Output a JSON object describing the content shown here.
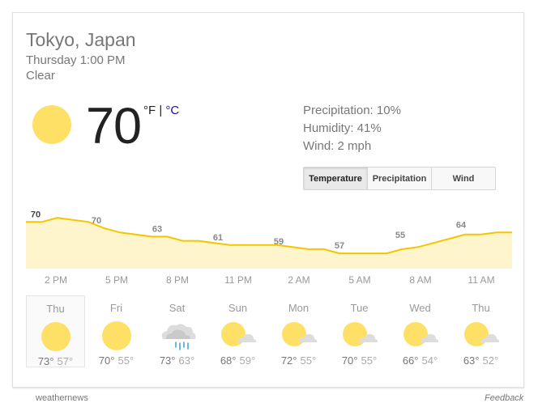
{
  "location": "Tokyo, Japan",
  "datetime": "Thursday 1:00 PM",
  "condition": "Clear",
  "current": {
    "temp": "70",
    "unit_f": "°F",
    "unit_sep": "|",
    "unit_c": "°C",
    "icon": "sun-icon"
  },
  "stats": {
    "precipitation": "Precipitation: 10%",
    "humidity": "Humidity: 41%",
    "wind": "Wind: 2 mph"
  },
  "tabs": [
    {
      "label": "Temperature",
      "active": true
    },
    {
      "label": "Precipitation",
      "active": false
    },
    {
      "label": "Wind",
      "active": false
    }
  ],
  "chart_data": {
    "type": "area",
    "x_labels": [
      "2 PM",
      "5 PM",
      "8 PM",
      "11 PM",
      "2 AM",
      "5 AM",
      "8 AM",
      "11 AM"
    ],
    "values": [
      70,
      70,
      72,
      71,
      70,
      67,
      65,
      64,
      63,
      63,
      61,
      61,
      60,
      59,
      59,
      59,
      59,
      58,
      57,
      57,
      55,
      55,
      55,
      55,
      57,
      58,
      60,
      62,
      64,
      64,
      65,
      65
    ],
    "labeled": [
      {
        "index": 0,
        "label": "70"
      },
      {
        "index": 3,
        "label": "70"
      },
      {
        "index": 6,
        "label": "63"
      },
      {
        "index": 9,
        "label": "61"
      },
      {
        "index": 12,
        "label": "59"
      },
      {
        "index": 15,
        "label": "57"
      },
      {
        "index": 18,
        "label": "55"
      },
      {
        "index": 21,
        "label": "64"
      }
    ],
    "line_color": "#f6c500",
    "fill_color": "#fff5cc",
    "label_color": "#888888"
  },
  "forecast": [
    {
      "day": "Thu",
      "hi": "73°",
      "lo": "57°",
      "icon": "sun-icon",
      "selected": true
    },
    {
      "day": "Fri",
      "hi": "70°",
      "lo": "55°",
      "icon": "sun-icon",
      "selected": false
    },
    {
      "day": "Sat",
      "hi": "73°",
      "lo": "63°",
      "icon": "rain-cloud-icon",
      "selected": false
    },
    {
      "day": "Sun",
      "hi": "68°",
      "lo": "59°",
      "icon": "partly-cloudy-icon",
      "selected": false
    },
    {
      "day": "Mon",
      "hi": "72°",
      "lo": "55°",
      "icon": "partly-cloudy-icon",
      "selected": false
    },
    {
      "day": "Tue",
      "hi": "70°",
      "lo": "55°",
      "icon": "partly-cloudy-icon",
      "selected": false
    },
    {
      "day": "Wed",
      "hi": "66°",
      "lo": "54°",
      "icon": "partly-cloudy-icon",
      "selected": false
    },
    {
      "day": "Thu",
      "hi": "63°",
      "lo": "52°",
      "icon": "partly-cloudy-icon",
      "selected": false
    }
  ],
  "footer": {
    "source": "weathernews",
    "feedback": "Feedback"
  },
  "colors": {
    "sun": "#ffe067",
    "cloud": "#d9d9d9",
    "rain": "#4aa6d8",
    "link": "#1a0dab"
  }
}
